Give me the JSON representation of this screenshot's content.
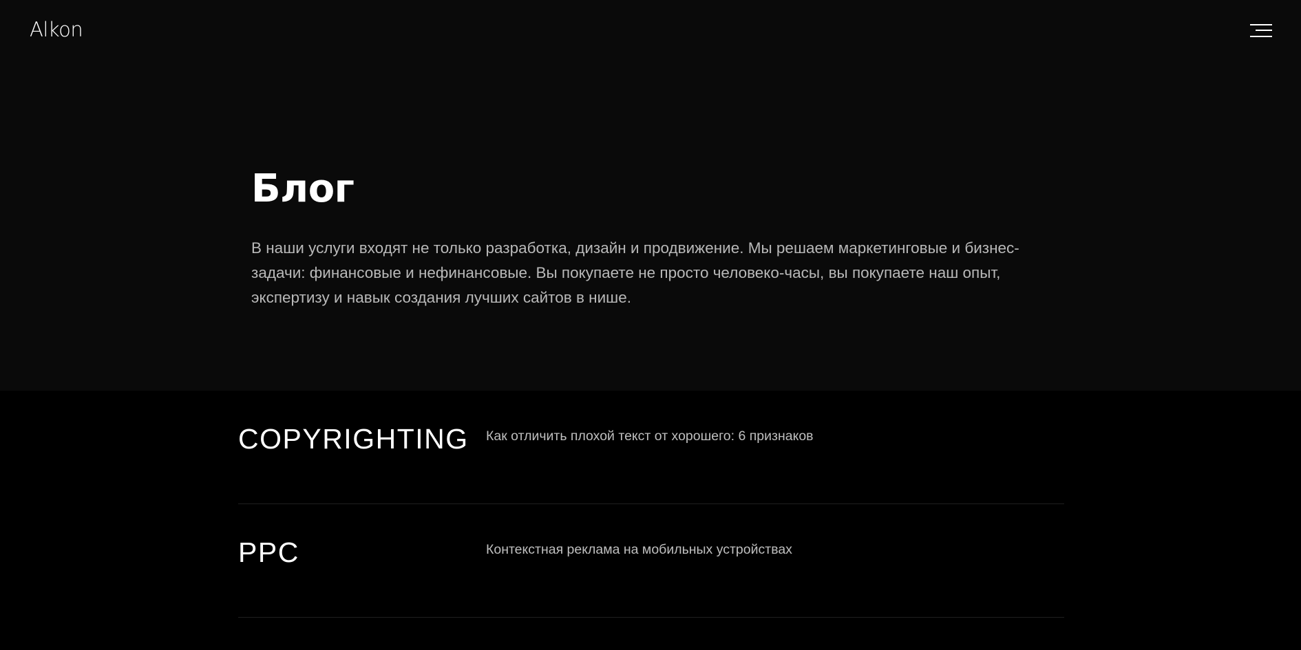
{
  "header": {
    "logo": "Alkon",
    "menu_icon": "hamburger-menu-icon"
  },
  "hero": {
    "title": "Блог",
    "description": "В наши услуги входят не только разработка, дизайн и продвижение. Мы решаем маркетинговые и бизнес-задачи: финансовые и нефинансовые. Вы покупаете не просто человеко-часы, вы покупаете наш опыт, экспертизу и навык создания лучших сайтов в нише."
  },
  "posts": [
    {
      "category": "COPYRIGHTING",
      "title": "Как отличить плохой текст от хорошего: 6 признаков"
    },
    {
      "category": "PPC",
      "title": "Контекстная реклама на мобильных устройствах"
    }
  ],
  "colors": {
    "hero_background": "#0a0a0a",
    "page_background": "#000000",
    "text_primary": "#ffffff",
    "text_secondary": "#b9b9b9",
    "divider": "#1f1f1f"
  }
}
